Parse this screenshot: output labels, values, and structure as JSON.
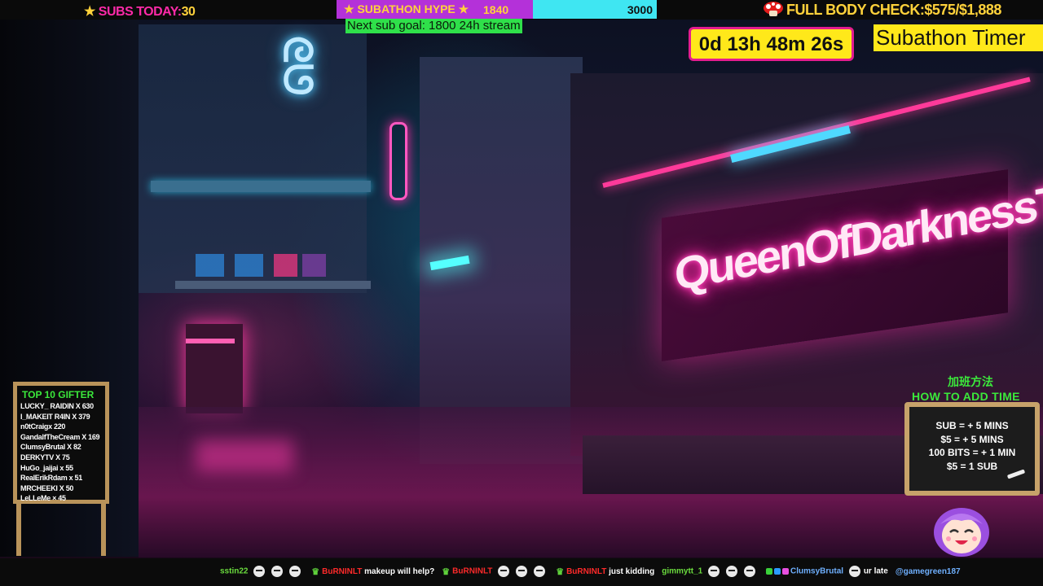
{
  "topbar": {
    "subs_today_label": "SUBS TODAY:",
    "subs_today_value": "30",
    "hype_label": "SUBATHON HYPE",
    "hype_current": "1840",
    "hype_goal": "3000",
    "hype_progress_fraction": 0.613,
    "next_goal": "Next sub goal: 1800  24h stream",
    "full_body_check": "FULL BODY CHECK:$575/$1,888"
  },
  "timer": {
    "countdown": "0d 13h 48m 26s",
    "title": "Subathon Timer"
  },
  "scene": {
    "neon_sign": "QueenOfDarknessTV"
  },
  "gifters": {
    "title": "TOP 10 GIFTER",
    "entries": [
      "LUCKY_ RAIDIN X 630",
      "I_MAKEIT R4IN X 379",
      "n0tCraigx 220",
      "GandalfTheCream X 169",
      "ClumsyBrutal X 82",
      "DERKYTV X 75",
      "HuGo_jaijai x 55",
      "RealErikRdam x 51",
      "MRCHEEKI X 50",
      "LeLLeMe × 45"
    ]
  },
  "how_to_add_time": {
    "title_zh": "加班方法",
    "title": "HOW TO ADD TIME",
    "rules": [
      "SUB = + 5 MINS",
      "$5 = + 5 MINS",
      "100 BITS = + 1 MIN",
      "$5 = 1 SUB"
    ]
  },
  "chat": [
    {
      "user": "sstin22",
      "message": "",
      "user_color": "green",
      "emotes": 3
    },
    {
      "user": "BuRNINLT",
      "message": "makeup will help?",
      "user_color": "red",
      "emotes": 0
    },
    {
      "user": "BuRNINLT",
      "message": "",
      "user_color": "red",
      "emotes": 3
    },
    {
      "user": "BuRNINLT",
      "message": "just kidding",
      "user_color": "red",
      "emotes": 0
    },
    {
      "user": "gimmytt_1",
      "message": "",
      "user_color": "green",
      "emotes": 3
    },
    {
      "user": "ClumsyBrutal",
      "message": "ur late",
      "user_color": "blue",
      "emotes": 1
    },
    {
      "user": "",
      "message": "@gamegreen187",
      "user_color": "blue",
      "emotes": 0
    }
  ],
  "colors": {
    "pink": "#ff2aa8",
    "yellow": "#ffd23b",
    "cyan": "#3fe6f2",
    "purple": "#b431d9",
    "green": "#2fe04a"
  }
}
